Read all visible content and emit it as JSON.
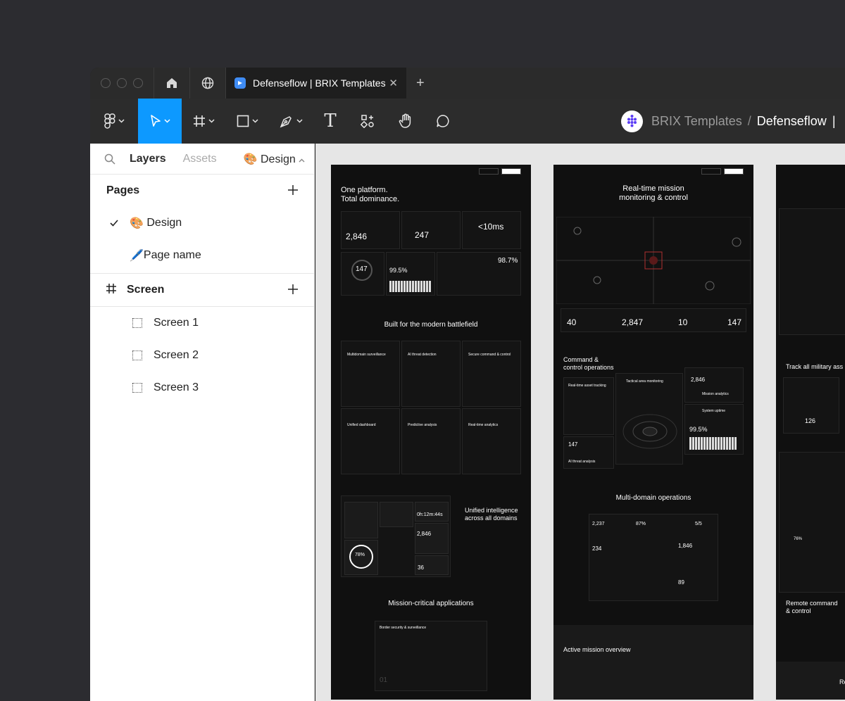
{
  "browser": {
    "tab_title": "Defenseflow | BRIX Templates",
    "new_tab": "+",
    "close": "✕"
  },
  "toolbar": {
    "breadcrumb_team": "BRIX Templates",
    "breadcrumb_sep": "/",
    "breadcrumb_project": "Defenseflow",
    "breadcrumb_bar": "|",
    "text_tool": "T"
  },
  "sidebar": {
    "tab_layers": "Layers",
    "tab_assets": "Assets",
    "design_emoji": "🎨",
    "design_label": "Design",
    "pages_title": "Pages",
    "pages": [
      {
        "emoji": "🎨",
        "label": "Design",
        "selected": true
      },
      {
        "emoji": "🖊️",
        "label": "Page name",
        "selected": false
      }
    ],
    "screen_title": "Screen",
    "screens": [
      "Screen 1",
      "Screen 2",
      "Screen 3"
    ]
  },
  "canvas": {
    "screen1": {
      "hero_l1": "One platform.",
      "hero_l2": "Total dominance.",
      "stat_a": "2,846",
      "stat_b": "247",
      "stat_c": "<10ms",
      "stat_d": "147",
      "stat_e": "99.5%",
      "stat_f": "98.7%",
      "section1": "Built for the modern battlefield",
      "features": [
        "Multidomain surveillance",
        "AI threat detection",
        "Secure command & control",
        "Unified dashboard",
        "Predictive analysis",
        "Real-time analytics"
      ],
      "uni_l1": "Unified intelligence",
      "uni_l2": "across all domains",
      "uni_timer": "0h:12m:44s",
      "uni_val": "2,846",
      "uni_pct": "78%",
      "uni_36": "36",
      "section2": "Mission-critical applications",
      "app1": "Border security & surveillance",
      "app_num": "01"
    },
    "screen2": {
      "hero_l1": "Real-time mission",
      "hero_l2": "monitoring & control",
      "stats": [
        "40",
        "2,847",
        "10",
        "147"
      ],
      "cmd_l1": "Command &",
      "cmd_l2": "control operations",
      "asset": "Real-time asset tracking",
      "tactical": "Tactical area monitoring",
      "mission": "Mission analytics",
      "uptime": "System uptime",
      "uptime_val": "99.5%",
      "val_2846": "2,846",
      "val_147": "147",
      "threat": "AI threat analysis",
      "multi": "Multi-domain operations",
      "m_vals": [
        "2,237",
        "87%",
        "5/5"
      ],
      "v234": "234",
      "v1846": "1,846",
      "v89": "89",
      "overview": "Active mission overview"
    },
    "screen3": {
      "track": "Track all military ass",
      "val126": "126",
      "pct76": "76%",
      "remote_l1": "Remote command",
      "remote_l2": "& control",
      "read": "Read"
    }
  }
}
